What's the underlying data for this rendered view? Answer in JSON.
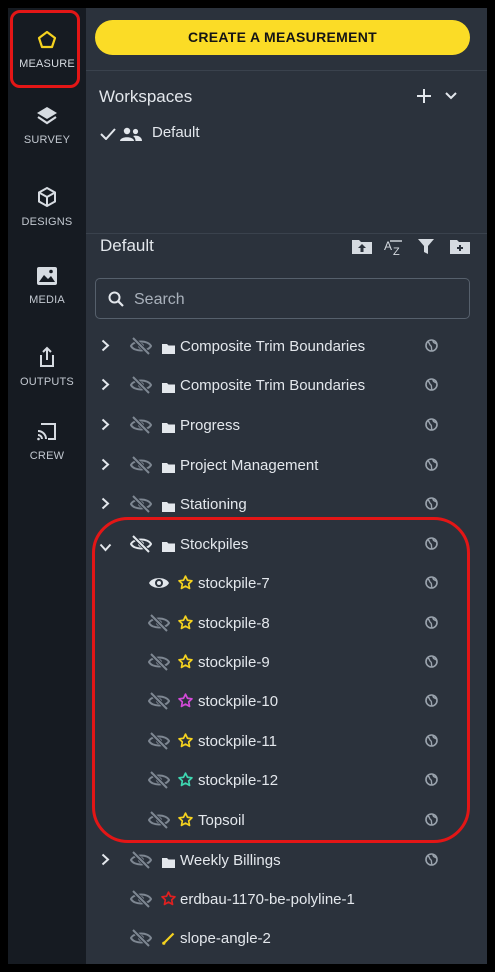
{
  "nav": [
    {
      "label": "MEASURE",
      "icon": "pentagon-icon"
    },
    {
      "label": "SURVEY",
      "icon": "layers-icon"
    },
    {
      "label": "DESIGNS",
      "icon": "cube-icon"
    },
    {
      "label": "MEDIA",
      "icon": "image-icon"
    },
    {
      "label": "OUTPUTS",
      "icon": "share-icon"
    },
    {
      "label": "CREW",
      "icon": "cast-icon"
    }
  ],
  "create_button": "CREATE A MEASUREMENT",
  "workspaces": {
    "title": "Workspaces",
    "items": [
      {
        "name": "Default"
      }
    ]
  },
  "layers": {
    "title": "Default",
    "search_placeholder": "Search",
    "rows": [
      {
        "label": "Composite Trim Boundaries"
      },
      {
        "label": "Composite Trim Boundaries"
      },
      {
        "label": "Progress"
      },
      {
        "label": "Project Management"
      },
      {
        "label": "Stationing"
      },
      {
        "label": "Stockpiles"
      },
      {
        "label": "stockpile-7",
        "color": "#f5d21f"
      },
      {
        "label": "stockpile-8",
        "color": "#f5d21f"
      },
      {
        "label": "stockpile-9",
        "color": "#f5d21f"
      },
      {
        "label": "stockpile-10",
        "color": "#d34ad9"
      },
      {
        "label": "stockpile-11",
        "color": "#f5d21f"
      },
      {
        "label": "stockpile-12",
        "color": "#3ed7b1"
      },
      {
        "label": "Topsoil",
        "color": "#f5d21f"
      },
      {
        "label": "Weekly Billings"
      },
      {
        "label": "erdbau-1170-be-polyline-1",
        "color": "#e02020"
      },
      {
        "label": "slope-angle-2",
        "color": "#f5d21f"
      }
    ]
  },
  "colors": {
    "accent": "#fbdc26",
    "highlight": "#e31616",
    "panel": "#2b323c",
    "rail": "#161b22"
  }
}
